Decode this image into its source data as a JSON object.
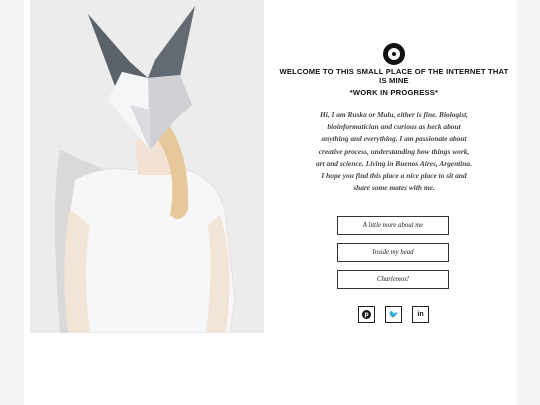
{
  "header": {
    "welcome": "WELCOME TO THIS SMALL PLACE OF THE INTERNET THAT IS MINE",
    "status": "*WORK IN PROGRESS*"
  },
  "bio": "Hi, I am Ruska or Malu, either is fine. Biologist, bioinformatician and curious as heck about anything and everything. I am passionate about creative process, understanding how things work, art and science. Living in Buenos Aires, Argentina. I hope you find this place a nice place to sit and share some mates with me.",
  "buttons": {
    "about": "A little more about me",
    "head": "Inside my head",
    "chat": "Charlemos!"
  },
  "social": [
    {
      "name": "pinterest-icon",
      "glyph": "p"
    },
    {
      "name": "twitter-icon",
      "glyph": "🐦"
    },
    {
      "name": "linkedin-icon",
      "glyph": "in"
    }
  ],
  "colors": {
    "background": "#f3f3f3",
    "card": "#ffffff",
    "text": "#111111"
  }
}
